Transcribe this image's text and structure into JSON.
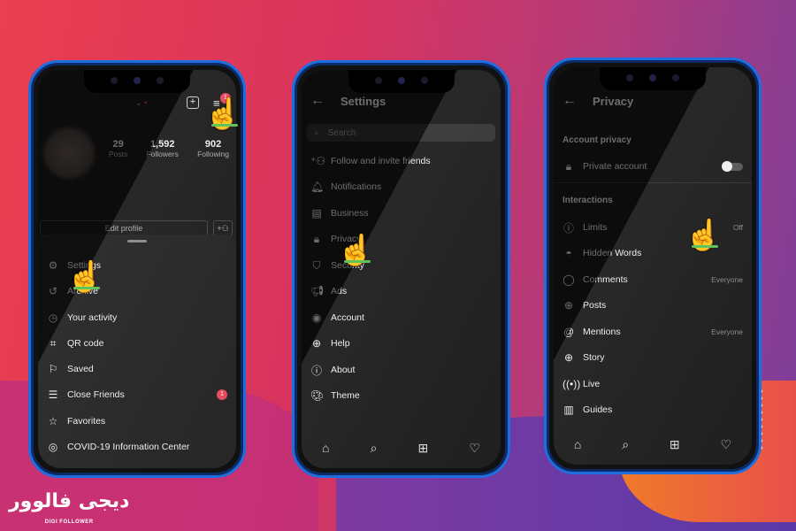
{
  "brand": {
    "logo_fa": "دیجی فالوور",
    "logo_en": "DIGI FOLLOWER",
    "bg_start": "#ea3f4f",
    "bg_end": "#7a3f9c",
    "bezel": "#1d6fe0"
  },
  "phone1": {
    "notification_count": "1",
    "stats": [
      {
        "value": "29",
        "label": "Posts"
      },
      {
        "value": "1,592",
        "label": "Followers"
      },
      {
        "value": "902",
        "label": "Following"
      }
    ],
    "edit_profile": "Edit profile",
    "menu": [
      {
        "icon": "settings-icon",
        "label": "Settings"
      },
      {
        "icon": "archive-icon",
        "label": "Archive"
      },
      {
        "icon": "activity-icon",
        "label": "Your activity"
      },
      {
        "icon": "qr-code-icon",
        "label": "QR code"
      },
      {
        "icon": "saved-icon",
        "label": "Saved"
      },
      {
        "icon": "close-friends-icon",
        "label": "Close Friends",
        "badge": "1"
      },
      {
        "icon": "star-icon",
        "label": "Favorites"
      },
      {
        "icon": "covid-info-icon",
        "label": "COVID-19 Information Center"
      }
    ]
  },
  "phone2": {
    "title": "Settings",
    "search_placeholder": "Search",
    "items": [
      {
        "icon": "add-person-icon",
        "label": "Follow and invite friends"
      },
      {
        "icon": "bell-icon",
        "label": "Notifications"
      },
      {
        "icon": "business-icon",
        "label": "Business"
      },
      {
        "icon": "lock-icon",
        "label": "Privacy"
      },
      {
        "icon": "shield-icon",
        "label": "Security"
      },
      {
        "icon": "megaphone-icon",
        "label": "Ads"
      },
      {
        "icon": "account-icon",
        "label": "Account"
      },
      {
        "icon": "help-icon",
        "label": "Help"
      },
      {
        "icon": "info-icon",
        "label": "About"
      },
      {
        "icon": "palette-icon",
        "label": "Theme"
      }
    ]
  },
  "phone3": {
    "title": "Privacy",
    "section_account": "Account privacy",
    "private_account": "Private account",
    "private_account_on": false,
    "section_interactions": "Interactions",
    "items": [
      {
        "icon": "limits-icon",
        "label": "Limits",
        "value": "Off"
      },
      {
        "icon": "eye-icon",
        "label": "Hidden Words",
        "value": ""
      },
      {
        "icon": "comment-icon",
        "label": "Comments",
        "value": "Everyone"
      },
      {
        "icon": "plus-square-icon",
        "label": "Posts",
        "value": ""
      },
      {
        "icon": "at-icon",
        "label": "Mentions",
        "value": "Everyone"
      },
      {
        "icon": "story-icon",
        "label": "Story",
        "value": ""
      },
      {
        "icon": "live-icon",
        "label": "Live",
        "value": ""
      },
      {
        "icon": "guides-icon",
        "label": "Guides",
        "value": ""
      }
    ]
  }
}
